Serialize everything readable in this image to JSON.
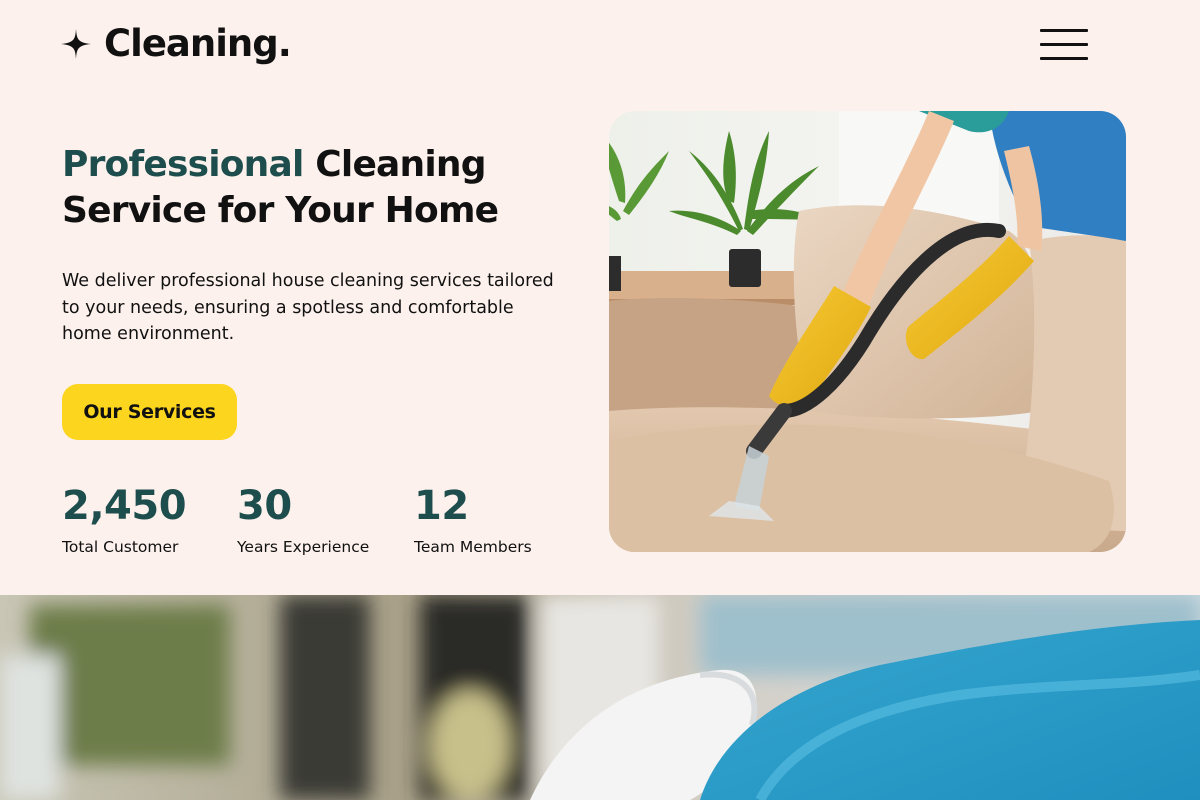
{
  "brand": {
    "name": "Cleaning.",
    "icon": "sparkle-icon"
  },
  "nav": {
    "menu_icon": "hamburger-menu-icon"
  },
  "hero": {
    "title_accent": "Professional",
    "title_rest_line1": " Cleaning",
    "title_line2": "Service for Your Home",
    "description": "We deliver professional house cleaning services tailored to your needs, ensuring a spotless and comfortable home environment.",
    "cta_label": "Our Services"
  },
  "stats": [
    {
      "value": "2,450",
      "label": "Total Customer"
    },
    {
      "value": "30",
      "label": "Years Experience"
    },
    {
      "value": "12",
      "label": "Team Members"
    }
  ],
  "colors": {
    "background": "#fcf1ec",
    "accent_teal": "#1e4d4d",
    "cta_yellow": "#fbd51e",
    "text": "#111111"
  }
}
